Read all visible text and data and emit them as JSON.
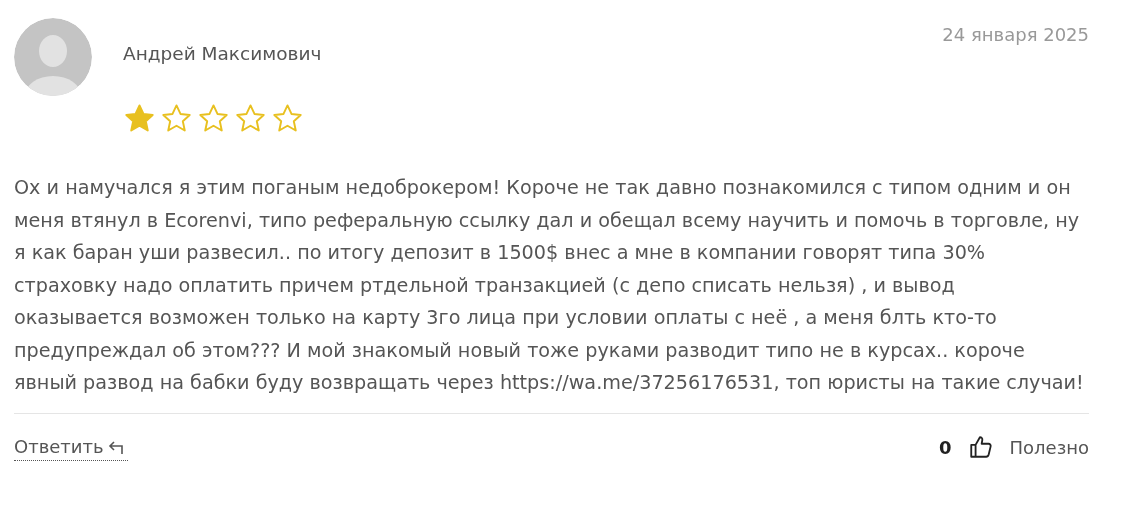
{
  "review": {
    "author": "Андрей Максимович",
    "date": "24 января 2025",
    "stars": 1,
    "text": "Ох и намучался я этим поганым недоброкером! Короче не так давно познакомился с типом одним и он меня втянул в Ecorenvi, типо реферальную ссылку дал и обещал всему научить и помочь в торговле, ну я как баран уши развесил.. по итогу депозит в 1500$ внес а мне в компании говорят типа 30% страховку надо оплатить причем ртдельной транзакцией (с депо списать нельзя) , и вывод оказывается возможен только на карту 3го лица при условии оплаты с неё , а меня блть кто-то предупреждал об этом??? И мой знакомый новый тоже руками разводит типо не в курсах.. короче явный развод на бабки буду возвращать через https://wa.me/37256176531, топ юристы на такие случаи!"
  },
  "footer": {
    "reply": "Ответить",
    "likes": "0",
    "helpful": "Полезно"
  }
}
